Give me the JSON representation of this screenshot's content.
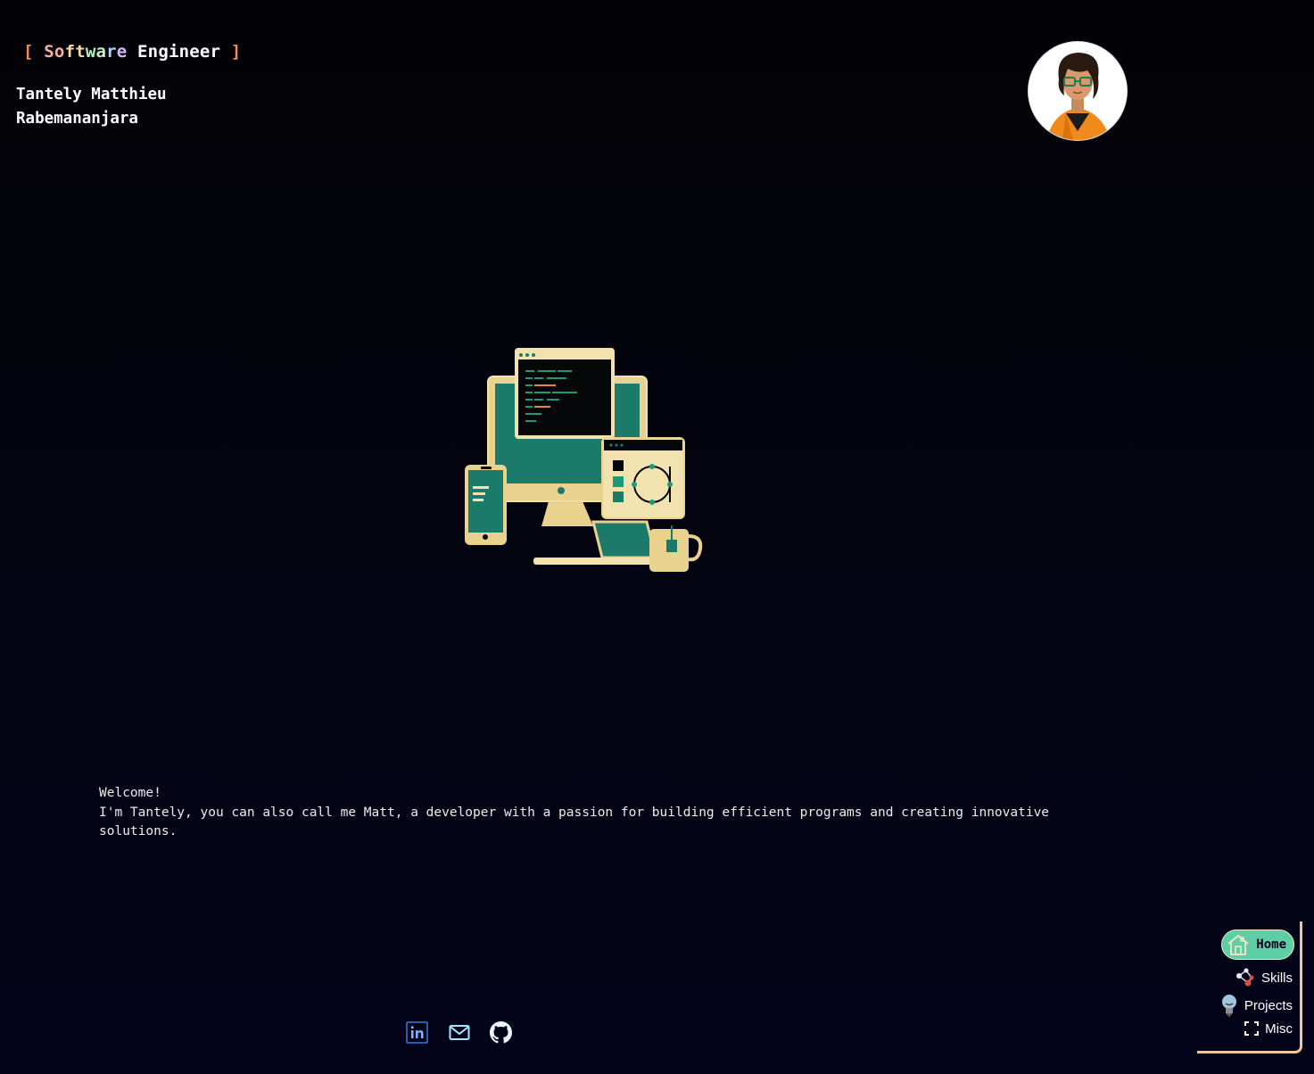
{
  "header": {
    "role_prefix": "[ ",
    "role_gradient": [
      "So",
      "ft",
      "wa",
      "r",
      "e"
    ],
    "role_rest": " Engineer",
    "role_suffix": " ]",
    "name_line1": "Tantely Matthieu",
    "name_line2": "Rabemananjara"
  },
  "intro": {
    "greeting": "Welcome!",
    "text": "I'm Tantely, you can also call me Matt, a developer with a passion for building efficient programs and creating innovative solutions."
  },
  "socials": [
    {
      "icon": "linkedin-icon"
    },
    {
      "icon": "mail-icon"
    },
    {
      "icon": "github-icon"
    }
  ],
  "nav": {
    "items": [
      {
        "label": "Home",
        "icon": "home-icon",
        "active": true
      },
      {
        "label": "Skills",
        "icon": "skills-network-icon"
      },
      {
        "label": "Projects",
        "icon": "lightbulb-icon"
      },
      {
        "label": "Misc",
        "icon": "expand-frame-icon"
      }
    ]
  },
  "colors": {
    "background": "#03041a",
    "accent": "#5ecfa4",
    "bracket": "#f08a5d",
    "nav_border": "#e8c9a0"
  }
}
